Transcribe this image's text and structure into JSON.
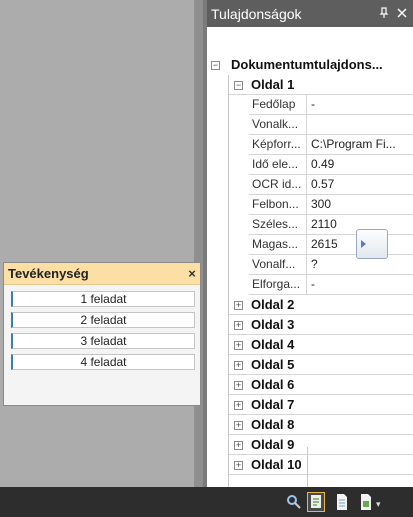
{
  "properties_panel": {
    "title": "Tulajdonságok",
    "pin_icon": "pin-icon",
    "close_icon": "close-icon",
    "root_label": "Dokumentumtulajdons...",
    "page1": {
      "label": "Oldal 1",
      "props": [
        {
          "name": "Fedőlap",
          "value": "-"
        },
        {
          "name": "Vonalk...",
          "value": ""
        },
        {
          "name": "Képforr...",
          "value": "C:\\Program Fi..."
        },
        {
          "name": "Idő ele...",
          "value": "0.49"
        },
        {
          "name": "OCR id...",
          "value": "0.57"
        },
        {
          "name": "Felbon...",
          "value": "300"
        },
        {
          "name": "Széles...",
          "value": "2110"
        },
        {
          "name": "Magas...",
          "value": "2615"
        },
        {
          "name": "Vonalf...",
          "value": "?"
        },
        {
          "name": "Elforga...",
          "value": "-"
        }
      ]
    },
    "pages": [
      "Oldal 2",
      "Oldal 3",
      "Oldal 4",
      "Oldal 5",
      "Oldal 6",
      "Oldal 7",
      "Oldal 8",
      "Oldal 9",
      "Oldal 10"
    ]
  },
  "activity_panel": {
    "title": "Tevékenység",
    "close": "×",
    "tasks": [
      "1 feladat",
      "2 feladat",
      "3 feladat",
      "4 feladat"
    ]
  },
  "expander": {
    "collapse": "−",
    "expand": "+"
  }
}
